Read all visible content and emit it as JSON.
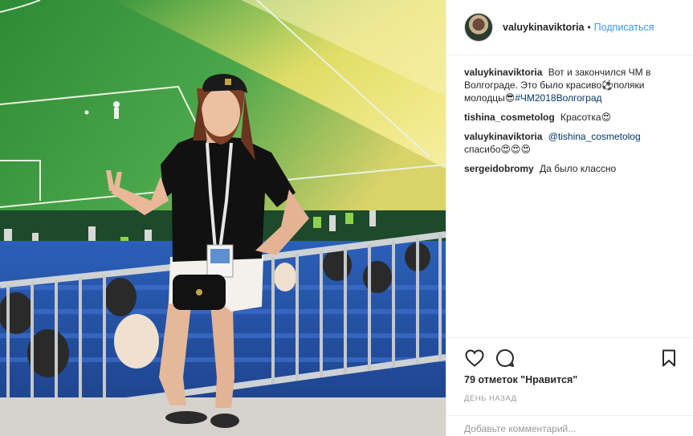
{
  "photo": {
    "alt_icon": "stadium-photo"
  },
  "header": {
    "username": "valuykinaviktoria",
    "separator": "•",
    "follow_label": "Подписаться"
  },
  "comments": [
    {
      "author": "valuykinaviktoria",
      "text": "Вот и закончился ЧМ в Волгограде. Это было красиво⚽️поляки молодцы😎",
      "hashtag": "#ЧМ2018Волгоград"
    },
    {
      "author": "tishina_cosmetolog",
      "text": "Красотка😍"
    },
    {
      "author": "valuykinaviktoria",
      "mention": "@tishina_cosmetolog",
      "text": "спасибо😍😍😍"
    },
    {
      "author": "sergeidobromy",
      "text": "Да было классно"
    }
  ],
  "actions": {
    "like_icon": "heart-icon",
    "comment_icon": "comment-bubble-icon",
    "save_icon": "bookmark-icon",
    "likes_text": "79 отметок \"Нравится\"",
    "time_text": "ДЕНЬ НАЗАД"
  },
  "add_comment": {
    "placeholder": "Добавьте комментарий..."
  }
}
